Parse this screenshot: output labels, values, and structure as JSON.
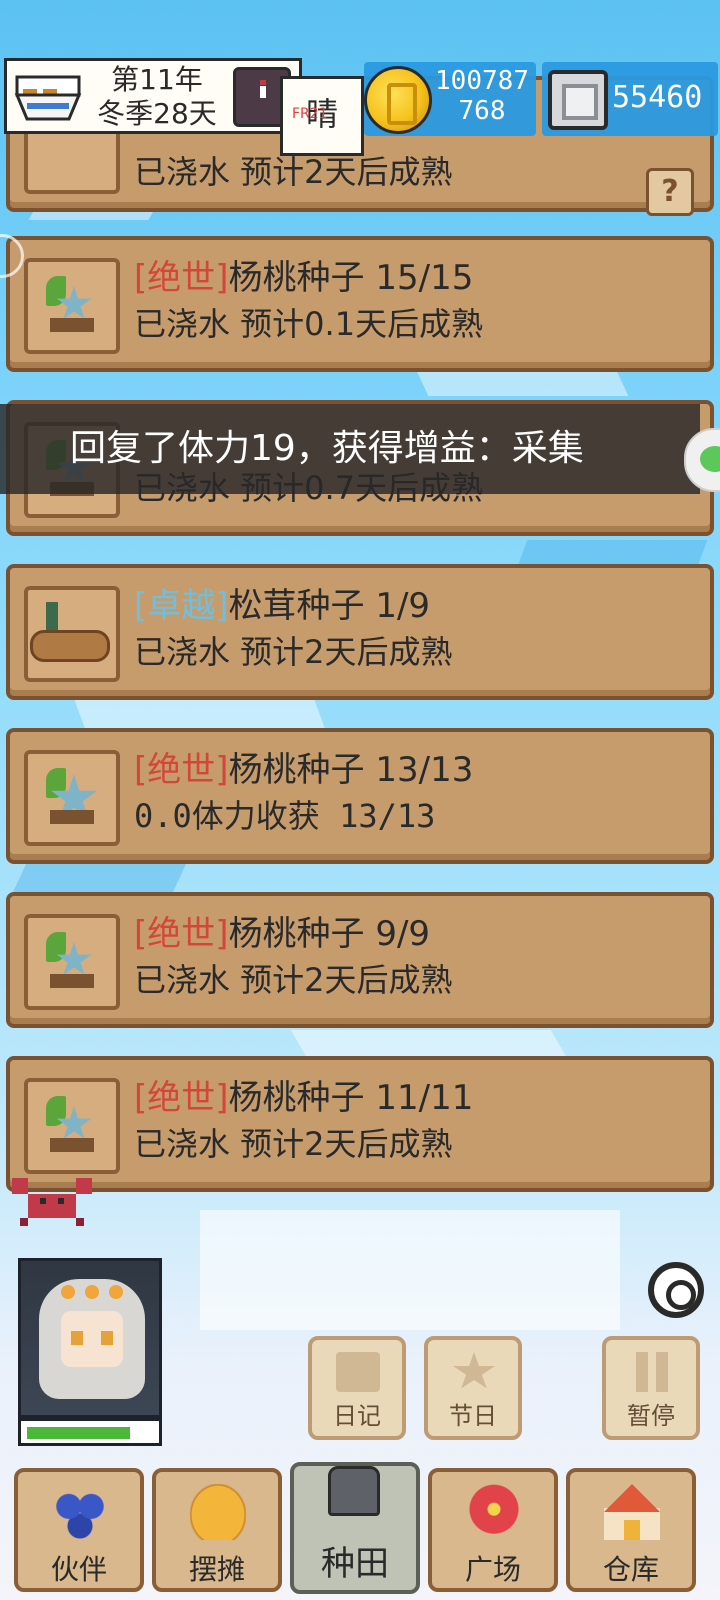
{
  "hud": {
    "year": "第11年",
    "season_day": "冬季28天",
    "weather": "晴",
    "weather_note": "FR21",
    "coins_line1": "100787",
    "coins_line2": "768",
    "gems": "55460"
  },
  "crops": [
    {
      "rarity": "",
      "name": "",
      "count": "",
      "status": "已浇水 预计2天后成熟"
    },
    {
      "rarity": "[绝世]",
      "name": "杨桃种子",
      "count": "15/15",
      "status": "已浇水 预计0.1天后成熟"
    },
    {
      "rarity": "",
      "name": "",
      "count": "",
      "status": "已浇水 预计0.7天后成熟"
    },
    {
      "rarity": "[卓越]",
      "name": "松茸种子",
      "count": "1/9",
      "status": "已浇水 预计2天后成熟"
    },
    {
      "rarity": "[绝世]",
      "name": "杨桃种子",
      "count": "13/13",
      "status": "0.0体力收获 13/13"
    },
    {
      "rarity": "[绝世]",
      "name": "杨桃种子",
      "count": "9/9",
      "status": "已浇水 预计2天后成熟"
    },
    {
      "rarity": "[绝世]",
      "name": "杨桃种子",
      "count": "11/11",
      "status": "已浇水 预计2天后成熟"
    }
  ],
  "toast": "回复了体力19，获得增益：采集",
  "help": "?",
  "character": {
    "hp_fraction": 0.82
  },
  "buttons": {
    "diary": "日记",
    "festival": "节日",
    "pause": "暂停"
  },
  "nav": [
    {
      "label": "伙伴",
      "icon": "blueberry-icon"
    },
    {
      "label": "摆摊",
      "icon": "pancake-icon"
    },
    {
      "label": "种田",
      "icon": "watering-can-icon",
      "active": true
    },
    {
      "label": "广场",
      "icon": "flower-icon"
    },
    {
      "label": "仓库",
      "icon": "house-icon"
    }
  ]
}
